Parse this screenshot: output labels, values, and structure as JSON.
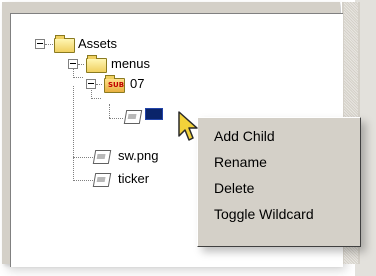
{
  "tree": {
    "nodes": [
      {
        "label": "Assets"
      },
      {
        "label": "menus"
      },
      {
        "label": "07",
        "badge": "SUB"
      },
      {
        "label": "sw.png"
      },
      {
        "label": "ticker"
      }
    ]
  },
  "context_menu": {
    "items": [
      "Add Child",
      "Rename",
      "Delete",
      "Toggle Wildcard"
    ]
  },
  "colors": {
    "panel": "#d4d0c8",
    "selection": "#0a246a",
    "folder": "#f0d060"
  }
}
